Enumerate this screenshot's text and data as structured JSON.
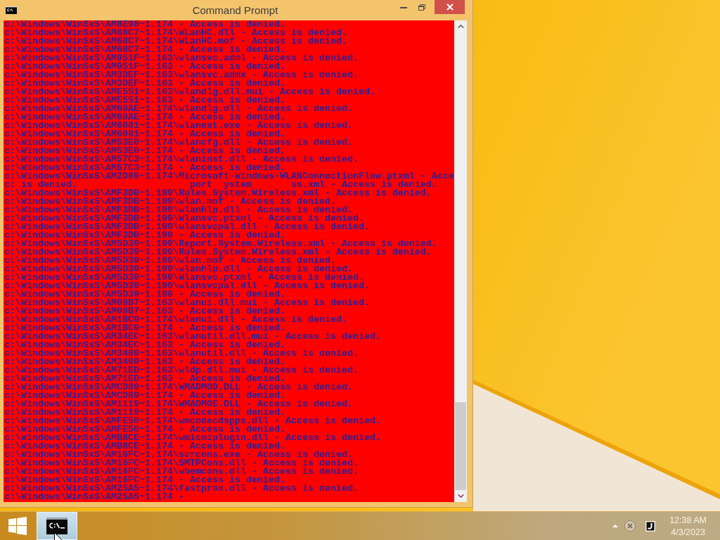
{
  "window": {
    "title": "Command Prompt"
  },
  "console": {
    "lines": [
      "c:\\Windows\\WinSxS\\AM8E98~1.174 - Access is denied.",
      "c:\\Windows\\WinSxS\\AM68C7~1.174\\WLanHC.dll - Access is denied.",
      "c:\\Windows\\WinSxS\\AM68C7~1.174\\WLanHC.mof - Access is denied.",
      "c:\\Windows\\WinSxS\\AM68C7~1.174 - Access is denied.",
      "c:\\Windows\\WinSxS\\AM951F~1.163\\wlansvc.adml - Access is denied.",
      "c:\\Windows\\WinSxS\\AM951F~1.163 - Access is denied.",
      "c:\\Windows\\WinSxS\\AM3DEF~1.163\\wlansvc.admx - Access is denied.",
      "c:\\Windows\\WinSxS\\AM3DEF~1.163 - Access is denied.",
      "c:\\Windows\\WinSxS\\AME551~1.163\\wlandlg.dll.mui - Access is denied.",
      "c:\\Windows\\WinSxS\\AME551~1.163 - Access is denied.",
      "c:\\Windows\\WinSxS\\AM60AE~1.174\\wlandlg.dll - Access is denied.",
      "c:\\Windows\\WinSxS\\AM60AE~1.174 - Access is denied.",
      "c:\\Windows\\WinSxS\\AM6081~1.174\\wlanext.exe - Access is denied.",
      "c:\\Windows\\WinSxS\\AM6081~1.174 - Access is denied.",
      "c:\\Windows\\WinSxS\\AM53E0~1.174\\wlancfg.dll - Access is denied.",
      "c:\\Windows\\WinSxS\\AM53E0~1.174 - Access is denied.",
      "c:\\Windows\\WinSxS\\AM57C3~1.174\\wlaninst.dll - Access is denied.",
      "c:\\Windows\\WinSxS\\AM57C3~1.174 - Access is denied.",
      "c:\\Windows\\WinSxS\\AM2D86~1.174\\Microsoft-Windows-WLANConnectionFlow.ptxml - Acce",
      "c: is denied.                    port  ystem       ss.xml - Access is denied.",
      "c:\\Windows\\WinSxS\\AMF3DB~1.199\\Rules.System.Wireless.xml - Access is denied.",
      "c:\\Windows\\WinSxS\\AMF3DB~1.199\\wlan.mof - Access is denied.",
      "c:\\Windows\\WinSxS\\AMF3DB~1.199\\wlanhlp.dll - Access is denied.",
      "c:\\Windows\\WinSxS\\AMF3DB~1.199\\Wlansvc.ptxml - Access is denied.",
      "c:\\Windows\\WinSxS\\AMF3DB~1.199\\wlansvcpal.dll - Access is denied.",
      "c:\\Windows\\WinSxS\\AMF3DB~1.199 - Access is denied.",
      "c:\\Windows\\WinSxS\\AM5D39~1.199\\Report.System.Wireless.xml - Access is denied.",
      "c:\\Windows\\WinSxS\\AM5D39~1.199\\Rules.System.Wireless.xml - Access is denied.",
      "c:\\Windows\\WinSxS\\AM5D39~1.199\\wlan.mof - Access is denied.",
      "c:\\Windows\\WinSxS\\AM5D39~1.199\\wlanhlp.dll - Access is denied.",
      "c:\\Windows\\WinSxS\\AM5D39~1.199\\Wlansvc.ptxml - Access is denied.",
      "c:\\Windows\\WinSxS\\AM5D39~1.199\\wlansvcpal.dll - Access is denied.",
      "c:\\Windows\\WinSxS\\AM5D39~1.199 - Access is denied.",
      "c:\\Windows\\WinSxS\\AM08B7~1.163\\wlanui.dll.mui - Access is denied.",
      "c:\\Windows\\WinSxS\\AM08B7~1.163 - Access is denied.",
      "c:\\Windows\\WinSxS\\AM1BC9~1.174\\wlanui.dll - Access is denied.",
      "c:\\Windows\\WinSxS\\AM1BC9~1.174 - Access is denied.",
      "c:\\Windows\\WinSxS\\AM34EC~1.163\\wlanutil.dll.mui - Access is denied.",
      "c:\\Windows\\WinSxS\\AM34EC~1.163 - Access is denied.",
      "c:\\Windows\\WinSxS\\AM3409~1.163\\wlanutil.dll - Access is denied.",
      "c:\\Windows\\WinSxS\\AM3409~1.163 - Access is denied.",
      "c:\\Windows\\WinSxS\\AM71ED~1.163\\wldp.dll.mui - Access is denied.",
      "c:\\Windows\\WinSxS\\AM71ED~1.163 - Access is denied.",
      "c:\\Windows\\WinSxS\\AMCD89~1.174\\WMADMOD.DLL - Access is denied.",
      "c:\\Windows\\WinSxS\\AMCD89~1.174 - Access is denied.",
      "c:\\Windows\\WinSxS\\AM1119~1.174\\WMADMOE.DLL - Access is denied.",
      "c:\\Windows\\WinSxS\\AM1119~1.174 - Access is denied.",
      "c:\\Windows\\WinSxS\\AMFE50~1.174\\wmcodecdspps.dll - Access is denied.",
      "c:\\Windows\\WinSxS\\AMFE50~1.174 - Access is denied.",
      "c:\\Windows\\WinSxS\\AMB8CE~1.174\\wmicmiplugin.dll - Access is denied.",
      "c:\\Windows\\WinSxS\\AMB8CE~1.174 - Access is denied.",
      "c:\\Windows\\WinSxS\\AM16FC~1.174\\scrcons.exe - Access is denied.",
      "c:\\Windows\\WinSxS\\AM16FC~1.174\\SMTPCons.dll - Access is denied.",
      "c:\\Windows\\WinSxS\\AM16FC~1.174\\wbemcons.dll - Access is denied.",
      "c:\\Windows\\WinSxS\\AM16FC~1.174 - Access is denied.",
      "c:\\Windows\\WinSxS\\AM25A5~1.174\\fastprox.dll - Access is denied.",
      "c:\\Windows\\WinSxS\\AM25A5~1.174 -"
    ]
  },
  "taskbar": {
    "apps": [
      {
        "kind": "console",
        "selected": true
      }
    ]
  },
  "tray": {
    "time": "12:38 AM",
    "date": "4/3/2023"
  }
}
